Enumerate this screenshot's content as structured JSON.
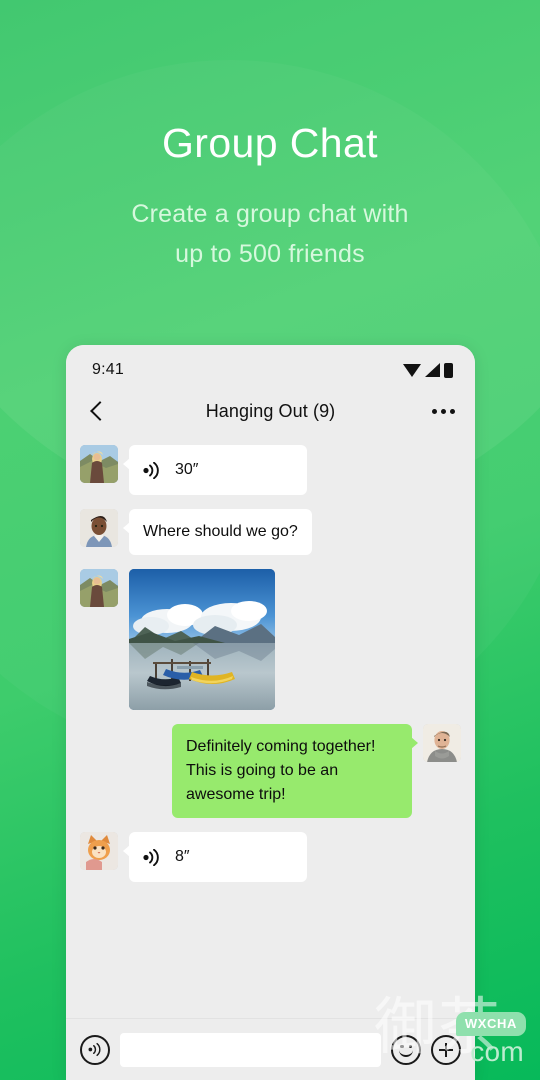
{
  "hero": {
    "title": "Group Chat",
    "subtitle_line1": "Create a group chat with",
    "subtitle_line2": "up to 500 friends"
  },
  "colors": {
    "bg_green_top": "#35c566",
    "bg_green_bottom": "#07b95a",
    "chat_bg": "#ededed",
    "bubble_in": "#ffffff",
    "bubble_out": "#97ea6d",
    "watermark_badge": "#8fe0ad"
  },
  "phone": {
    "statusbar": {
      "time": "9:41",
      "icons": [
        "wifi-icon",
        "signal-icon",
        "battery-icon"
      ]
    },
    "navbar": {
      "back_icon": "chevron-left-icon",
      "title": "Hanging Out (9)",
      "more_icon": "more-horizontal-icon"
    },
    "messages": [
      {
        "id": "msg-1",
        "direction": "in",
        "type": "voice",
        "duration": "30″",
        "icon": "voice-wave-icon",
        "avatar": "avatar-woman-hiker"
      },
      {
        "id": "msg-2",
        "direction": "in",
        "type": "text",
        "text": "Where should we go?",
        "avatar": "avatar-man-denim"
      },
      {
        "id": "msg-3",
        "direction": "in",
        "type": "image",
        "image_alt": "lake-boats-photo",
        "avatar": "avatar-woman-hiker"
      },
      {
        "id": "msg-4",
        "direction": "out",
        "type": "text",
        "text": "Definitely coming together! This is going to be an awesome trip!",
        "avatar": "avatar-man-turtleneck"
      },
      {
        "id": "msg-5",
        "direction": "in",
        "type": "voice",
        "duration": "8″",
        "icon": "voice-wave-icon",
        "avatar": "avatar-orange-cat"
      }
    ],
    "toolbar": {
      "voice_icon": "voice-record-icon",
      "input_value": "",
      "input_placeholder": "",
      "emoji_icon": "emoji-smiley-icon",
      "plus_icon": "plus-circle-icon"
    }
  },
  "watermark": {
    "cjk": "御茶",
    "badge": "WXCHA",
    "domain": "com"
  }
}
